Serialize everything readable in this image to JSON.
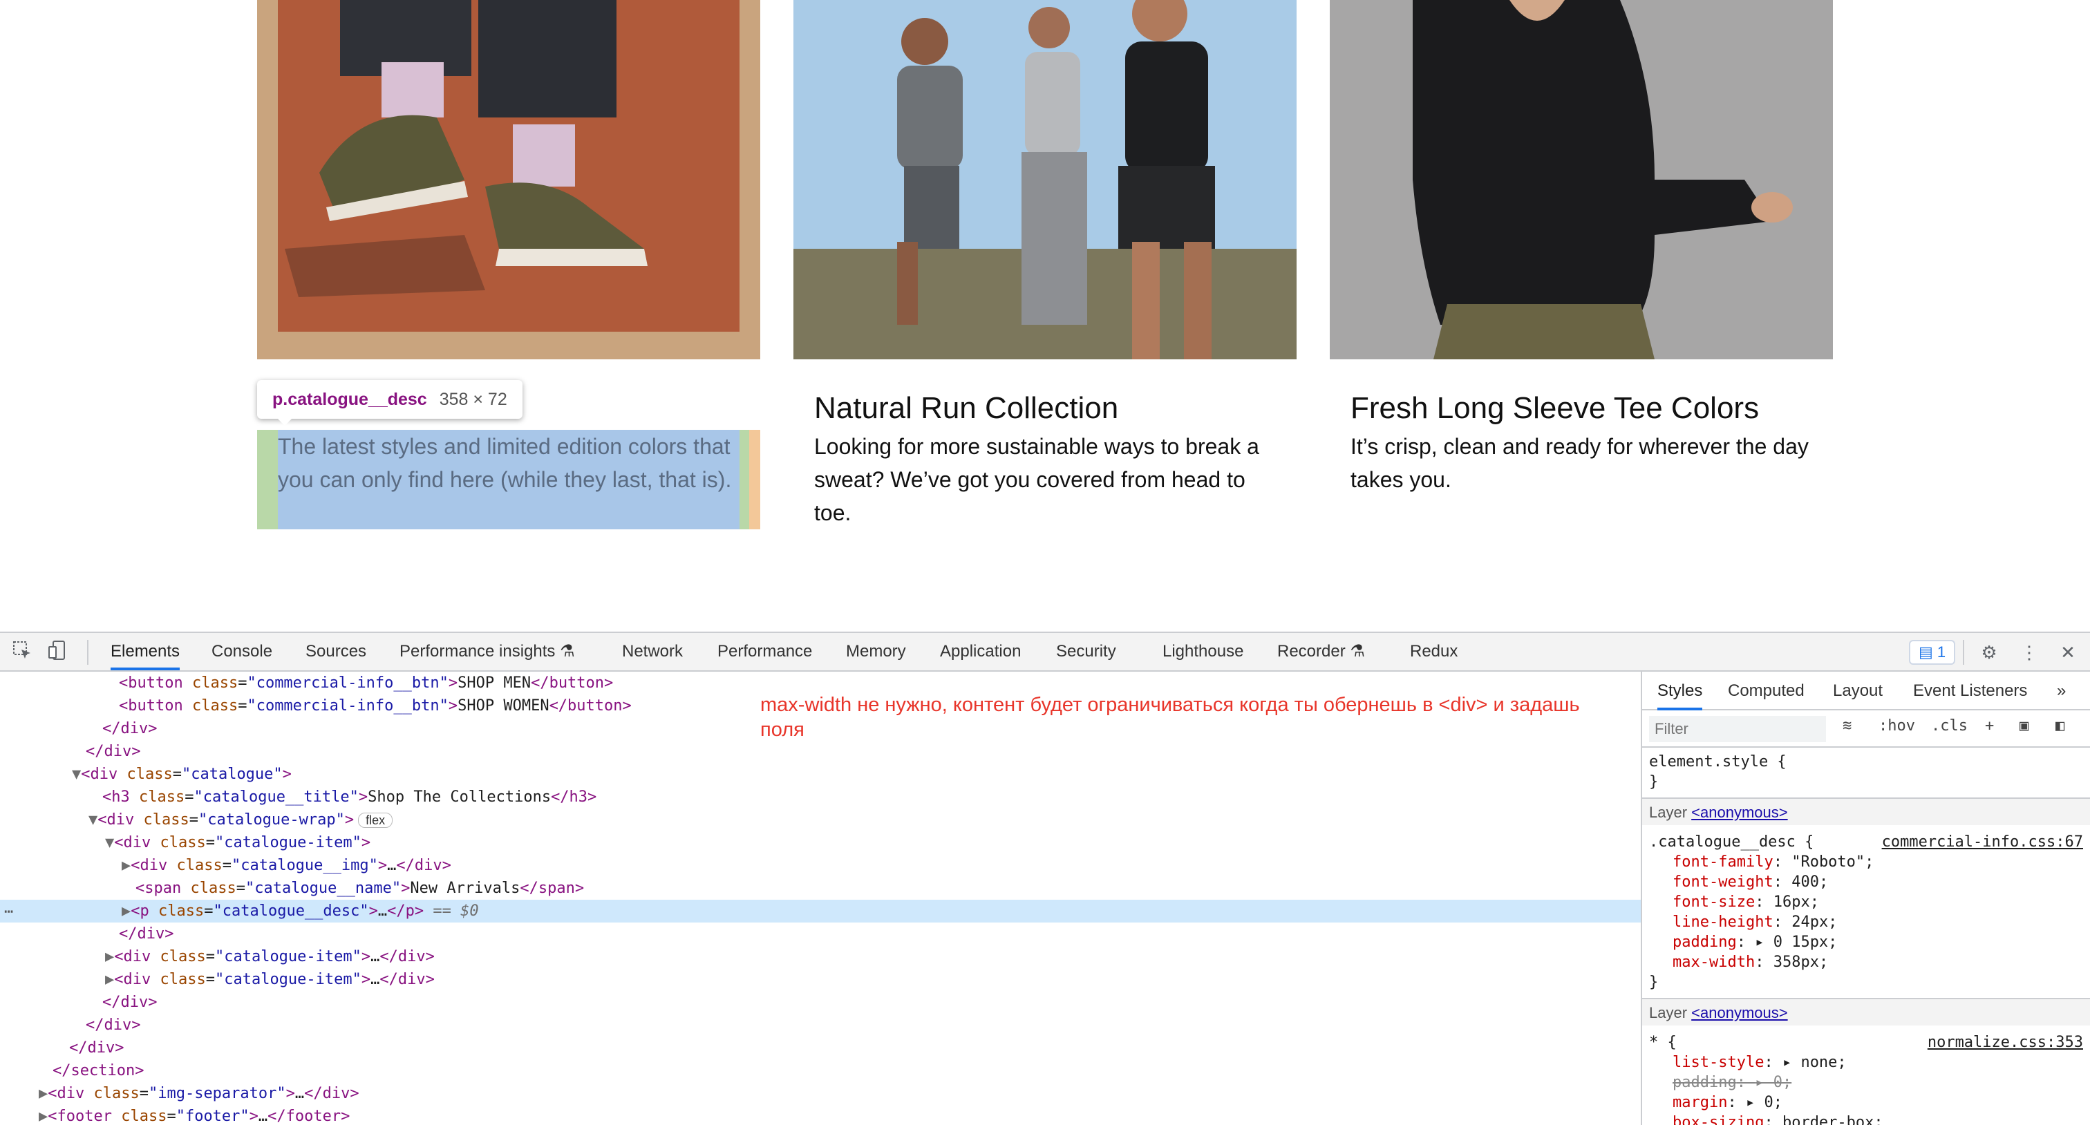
{
  "catalogue": {
    "items": [
      {
        "name": "New Arrivals",
        "desc": "The latest styles and limited edition colors that you can only find here (while they last, that is)."
      },
      {
        "name": "Natural Run Collection",
        "desc": "Looking for more sustainable ways to break a sweat? We’ve got you covered from head to toe."
      },
      {
        "name": "Fresh Long Sleeve Tee Colors",
        "desc": "It’s crisp, clean and ready for wherever the day takes you."
      }
    ],
    "tooltip": {
      "selector": "p.catalogue__desc",
      "size": "358 × 72"
    }
  },
  "devtools": {
    "tabs": [
      "Elements",
      "Console",
      "Sources",
      "Performance insights",
      "Network",
      "Performance",
      "Memory",
      "Application",
      "Security",
      "Lighthouse",
      "Recorder",
      "Redux"
    ],
    "issues_count": "1",
    "note": "max-width не нужно, контент будет ограничиваться когда ты обернешь в <div> и задашь поля",
    "dom": {
      "btn_men": "SHOP MEN",
      "btn_women": "SHOP WOMEN",
      "title": "Shop The Collections",
      "span_name": "New Arrivals",
      "flex_pill": "flex",
      "sel_marker": "== $0"
    },
    "styles": {
      "tabs": [
        "Styles",
        "Computed",
        "Layout",
        "Event Listeners"
      ],
      "filter_placeholder": "Filter",
      "hov": ":hov",
      "cls": ".cls",
      "element_style": "element.style {",
      "layer_label": "Layer",
      "layer_link": "<anonymous>",
      "rule1_selector": ".catalogue__desc {",
      "rule1_source": "commercial-info.css:67",
      "rule1_props": [
        {
          "name": "font-family",
          "value": "\"Roboto\";"
        },
        {
          "name": "font-weight",
          "value": "400;"
        },
        {
          "name": "font-size",
          "value": "16px;"
        },
        {
          "name": "line-height",
          "value": "24px;"
        },
        {
          "name": "padding",
          "value": "▸ 0 15px;"
        },
        {
          "name": "max-width",
          "value": "358px;"
        }
      ],
      "rule2_selector": "* {",
      "rule2_source": "normalize.css:353",
      "rule2_props": [
        {
          "name": "list-style",
          "value": "▸ none;"
        },
        {
          "name": "padding",
          "value": "▸ 0;"
        },
        {
          "name": "margin",
          "value": "▸ 0;"
        },
        {
          "name": "box-sizing",
          "value": "border-box;"
        }
      ]
    }
  }
}
